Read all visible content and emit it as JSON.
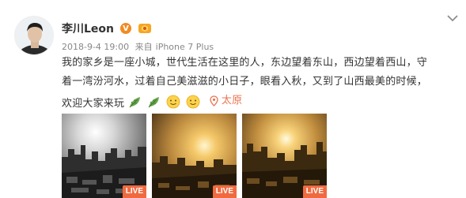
{
  "post": {
    "author": "李川Leon",
    "verified_badge": "V",
    "date": "2018-9-4 19:00",
    "source_prefix": "来自",
    "source": "iPhone 7 Plus",
    "text_line1": "我的家乡是一座小城，世代生活在这里的人，东边望着东山，西边望着西山，守",
    "text_line2": "着一湾汾河水，过着自己美滋滋的小日子，眼看入秋，又到了山西最美的时候，",
    "text_line3": "欢迎大家来玩",
    "location": "太原",
    "emojis": [
      "leaf-icon",
      "leaf-icon",
      "smile-face-icon",
      "smile-face-icon"
    ]
  },
  "photos": [
    {
      "live_label": "LIVE",
      "tone": "monochrome"
    },
    {
      "live_label": "LIVE",
      "tone": "golden"
    },
    {
      "live_label": "LIVE",
      "tone": "golden"
    }
  ],
  "colors": {
    "accent_orange": "#eb7350",
    "verified_orange": "#f28a22",
    "live_badge": "#f06a40",
    "meta_gray": "#888888"
  }
}
